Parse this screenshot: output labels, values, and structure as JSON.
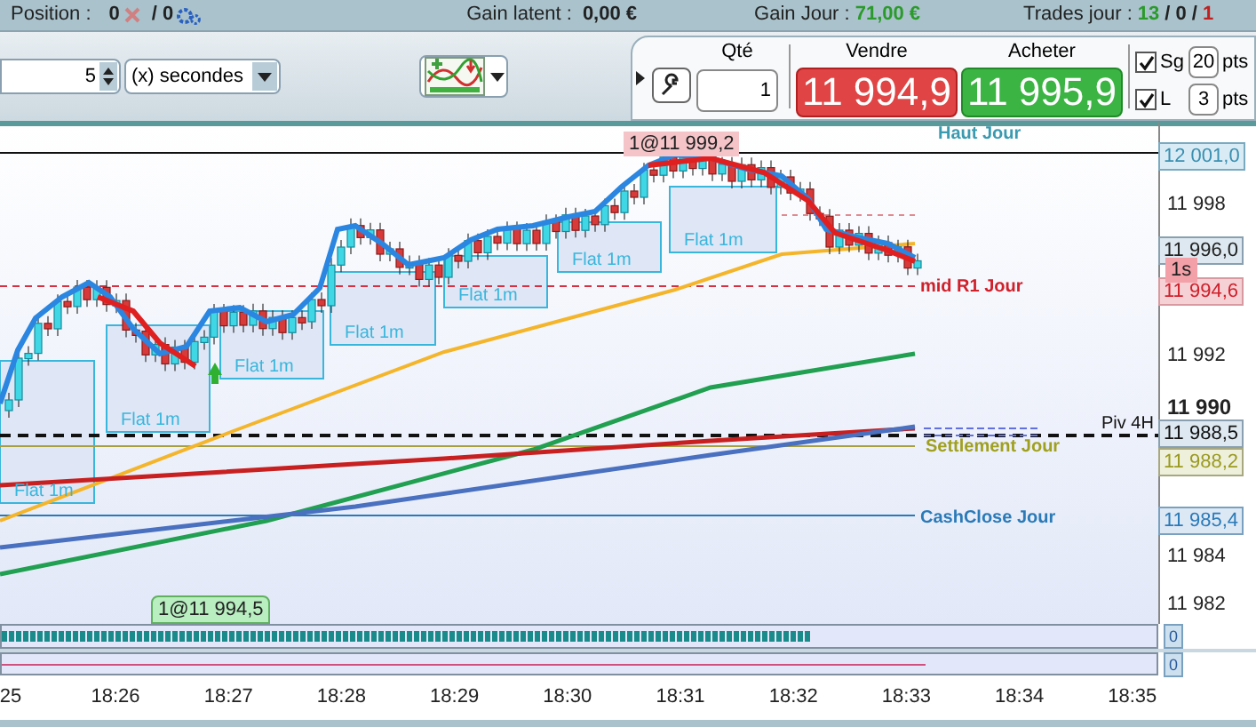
{
  "status_bar": {
    "position_label": "Position :",
    "position_value": "0",
    "position_total": "/ 0",
    "gain_latent_label": "Gain latent :",
    "gain_latent_value": "0,00 €",
    "gain_jour_label": "Gain Jour :",
    "gain_jour_value": "71,00 €",
    "trades_label": "Trades jour :",
    "trades_won": "13",
    "trades_flat": "/ 0 /",
    "trades_lost": "1"
  },
  "toolbar": {
    "interval_value": "5",
    "interval_unit": "(x) secondes"
  },
  "order_panel": {
    "qty_label": "Qté",
    "qty_value": "1",
    "sell_label": "Vendre",
    "sell_price": "11 994,9",
    "buy_label": "Acheter",
    "buy_price": "11 995,9",
    "options": [
      {
        "label": "Sg",
        "checked": true,
        "value": "20",
        "unit": "pts"
      },
      {
        "label": "L",
        "checked": true,
        "value": "3",
        "unit": "pts"
      }
    ]
  },
  "chart": {
    "price_ticks": [
      {
        "label": "11 998",
        "bold": false
      },
      {
        "label": "11 992",
        "bold": false
      },
      {
        "label": "11 990",
        "bold": true
      },
      {
        "label": "11 984",
        "bold": false
      },
      {
        "label": "11 982",
        "bold": false
      }
    ],
    "price_tags": [
      {
        "text": "12 001,0",
        "kind": "high"
      },
      {
        "text": "11 996,0",
        "kind": "last"
      },
      {
        "text": "11 994,6",
        "kind": "r1"
      },
      {
        "text": "11 988,5",
        "kind": "pivot"
      },
      {
        "text": "11 988,2",
        "kind": "settlement"
      },
      {
        "text": "11 985,4",
        "kind": "cashclose"
      }
    ],
    "timer_tag": "1s",
    "level_labels": [
      {
        "text": "Haut Jour",
        "kind": "high"
      },
      {
        "text": "mid R1 Jour",
        "kind": "r1"
      },
      {
        "text": "Piv 4H",
        "kind": "pivot"
      },
      {
        "text": "Settlement Jour",
        "kind": "settlement"
      },
      {
        "text": "CashClose Jour",
        "kind": "cashclose"
      }
    ],
    "order_markers": [
      {
        "text": "1@11 999,2",
        "kind": "sell"
      },
      {
        "text": "1@11 994,5",
        "kind": "buy"
      }
    ],
    "flat_labels": [
      "Flat 1m",
      "Flat 1m",
      "Flat 1m",
      "Flat 1m",
      "Flat 1m",
      "Flat 1m",
      "Flat 1m"
    ],
    "indicator_values": [
      "0",
      "0"
    ],
    "time_ticks": [
      "25",
      "18:26",
      "18:27",
      "18:28",
      "18:29",
      "18:30",
      "18:31",
      "18:32",
      "18:33",
      "18:34",
      "18:35"
    ]
  }
}
